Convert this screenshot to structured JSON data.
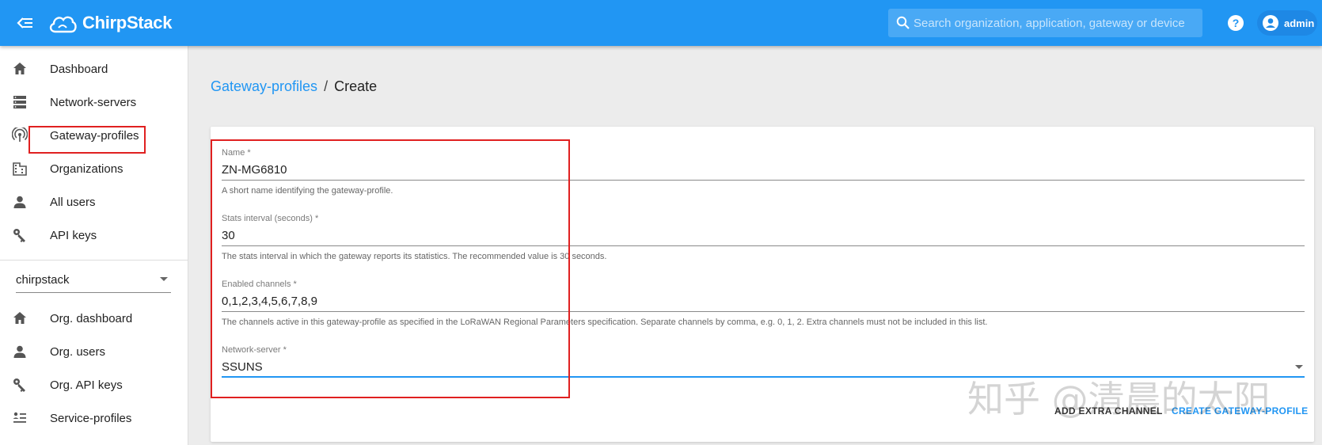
{
  "header": {
    "app_name": "ChirpStack",
    "search_placeholder": "Search organization, application, gateway or device",
    "user": "admin"
  },
  "sidebar": {
    "items": [
      {
        "label": "Dashboard",
        "icon": "home-icon"
      },
      {
        "label": "Network-servers",
        "icon": "server-icon"
      },
      {
        "label": "Gateway-profiles",
        "icon": "gateway-icon"
      },
      {
        "label": "Organizations",
        "icon": "building-icon"
      },
      {
        "label": "All users",
        "icon": "user-icon"
      },
      {
        "label": "API keys",
        "icon": "key-icon"
      }
    ],
    "organization": "chirpstack",
    "org_items": [
      {
        "label": "Org. dashboard",
        "icon": "home-icon"
      },
      {
        "label": "Org. users",
        "icon": "user-icon"
      },
      {
        "label": "Org. API keys",
        "icon": "key-icon"
      },
      {
        "label": "Service-profiles",
        "icon": "list-icon"
      }
    ]
  },
  "breadcrumb": {
    "parent": "Gateway-profiles",
    "separator": "/",
    "current": "Create"
  },
  "form": {
    "name": {
      "label": "Name *",
      "value": "ZN-MG6810",
      "helper": "A short name identifying the gateway-profile."
    },
    "stats_interval": {
      "label": "Stats interval (seconds) *",
      "value": "30",
      "helper": "The stats interval in which the gateway reports its statistics. The recommended value is 30 seconds."
    },
    "channels": {
      "label": "Enabled channels *",
      "value": "0,1,2,3,4,5,6,7,8,9",
      "helper": "The channels active in this gateway-profile as specified in the LoRaWAN Regional Parameters specification. Separate channels by comma, e.g. 0, 1, 2. Extra channels must not be included in this list."
    },
    "network_server": {
      "label": "Network-server *",
      "value": "SSUNS"
    },
    "add_extra_channel": "ADD EXTRA CHANNEL",
    "create": "CREATE GATEWAY-PROFILE"
  },
  "watermark": "知乎 @清晨的太阳",
  "colors": {
    "primary": "#2196f3",
    "highlight": "#e02020"
  }
}
